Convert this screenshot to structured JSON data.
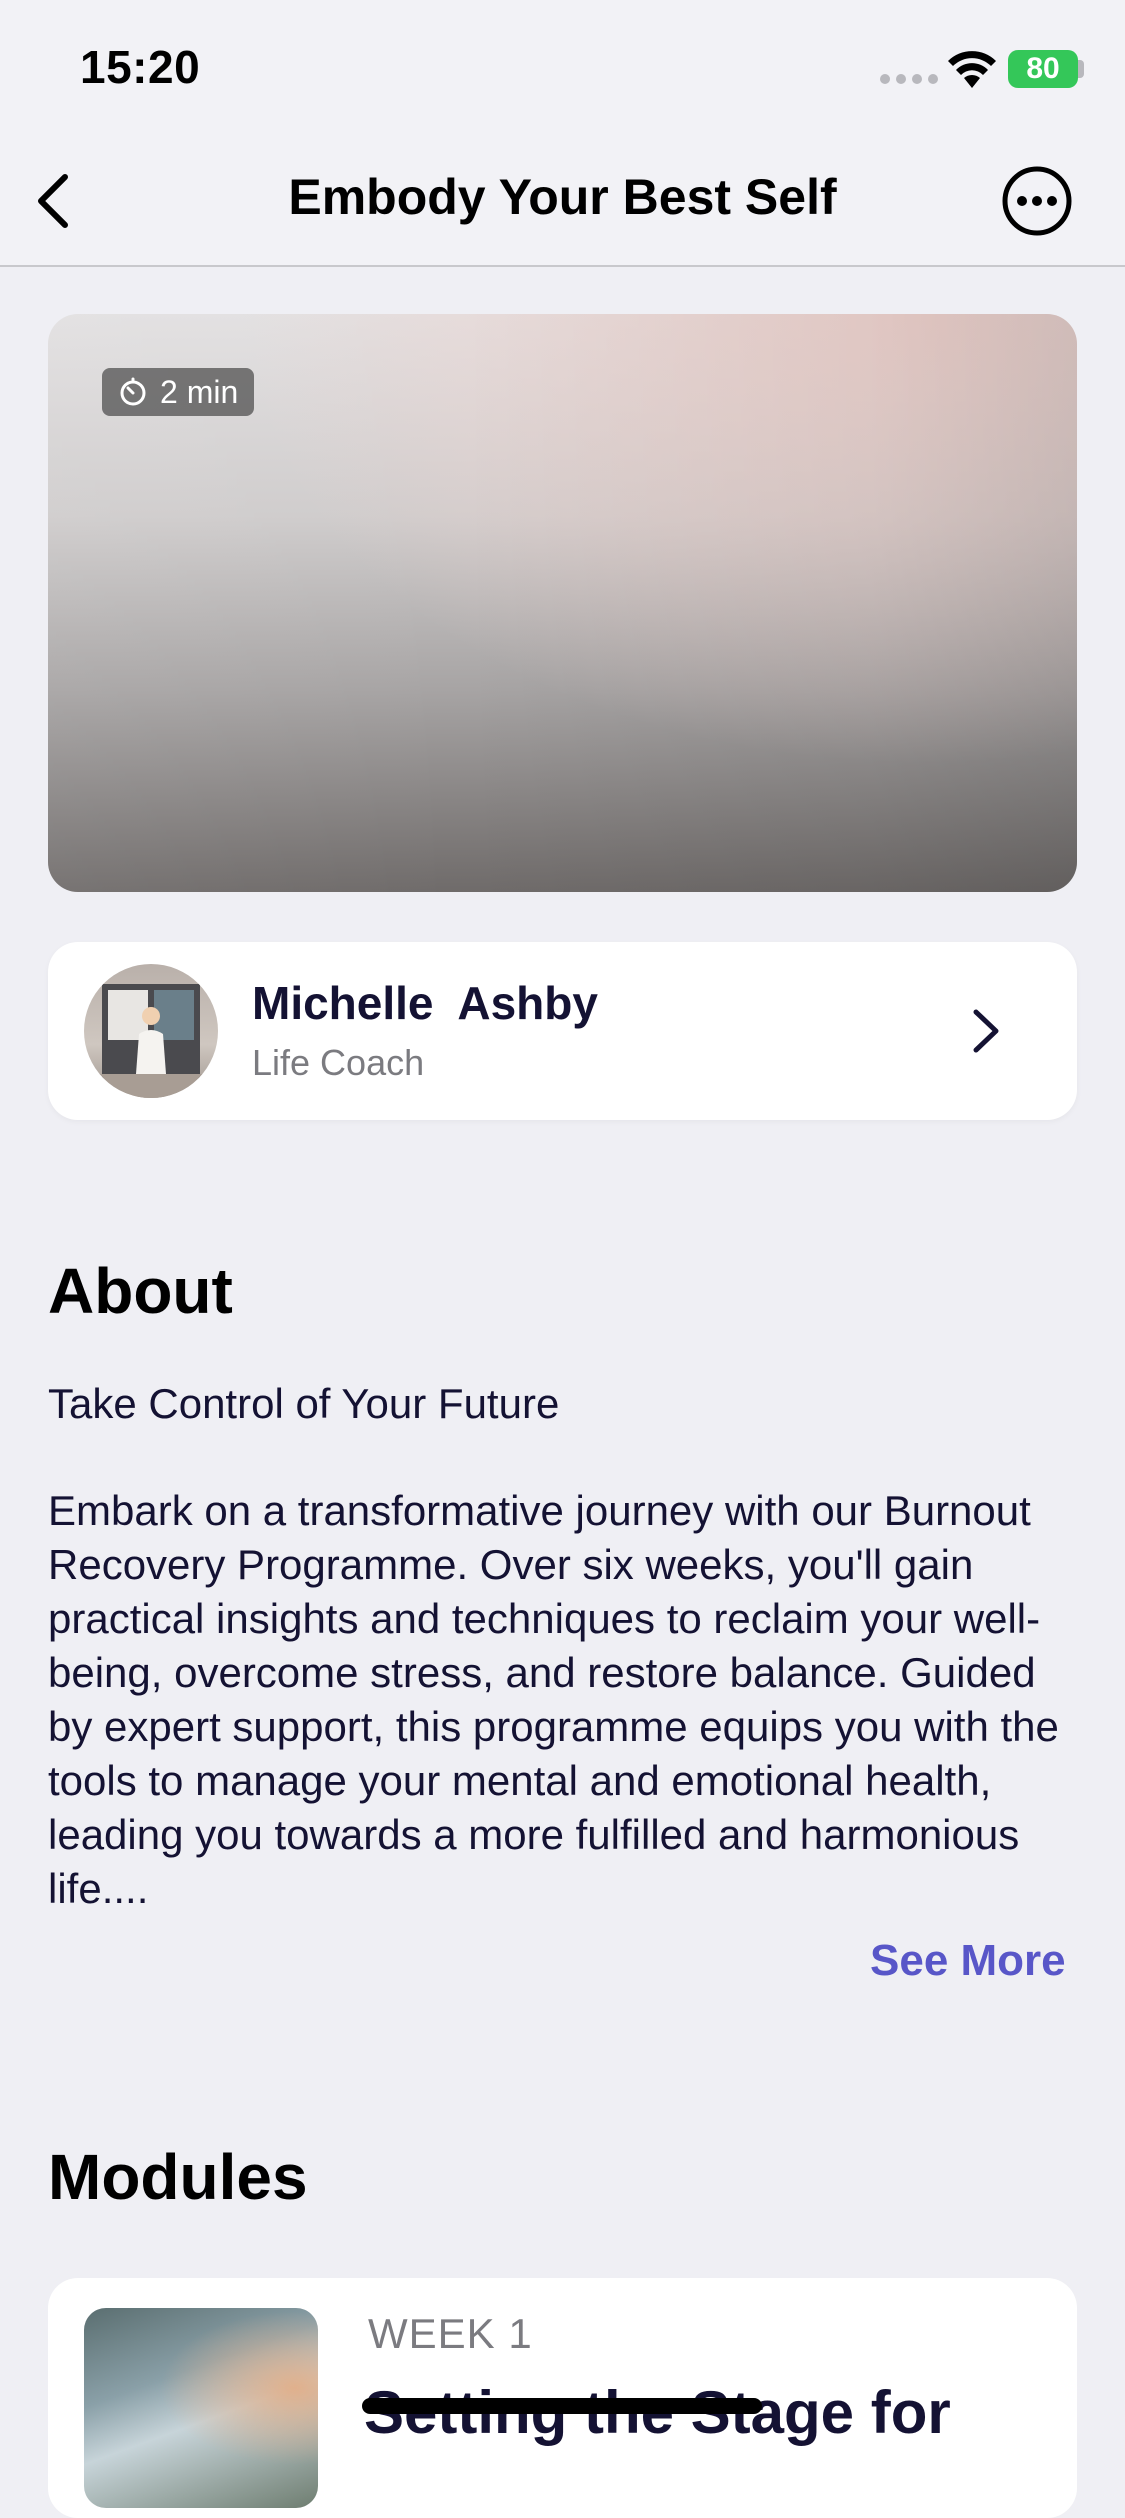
{
  "status_bar": {
    "time": "15:20",
    "battery": "80"
  },
  "nav": {
    "title": "Embody Your Best Self"
  },
  "video": {
    "duration": "2 min"
  },
  "coach": {
    "name": "Michelle  Ashby",
    "role": "Life Coach"
  },
  "about": {
    "heading": "About",
    "subtitle": "Take Control of Your Future",
    "body": "Embark on a transformative journey with our Burnout Recovery Programme. Over six weeks, you'll gain practical insights and techniques to reclaim your well-being, overcome stress, and restore balance. Guided by expert support, this programme equips you with the tools to manage your mental and emotional health, leading you towards a more fulfilled and harmonious life....",
    "see_more": "See More"
  },
  "modules": {
    "heading": "Modules",
    "items": [
      {
        "week": "WEEK 1",
        "title": "Setting the Stage for"
      }
    ]
  },
  "colors": {
    "accent": "#5856c8",
    "battery_green": "#34c759",
    "text_dark": "#141233"
  }
}
